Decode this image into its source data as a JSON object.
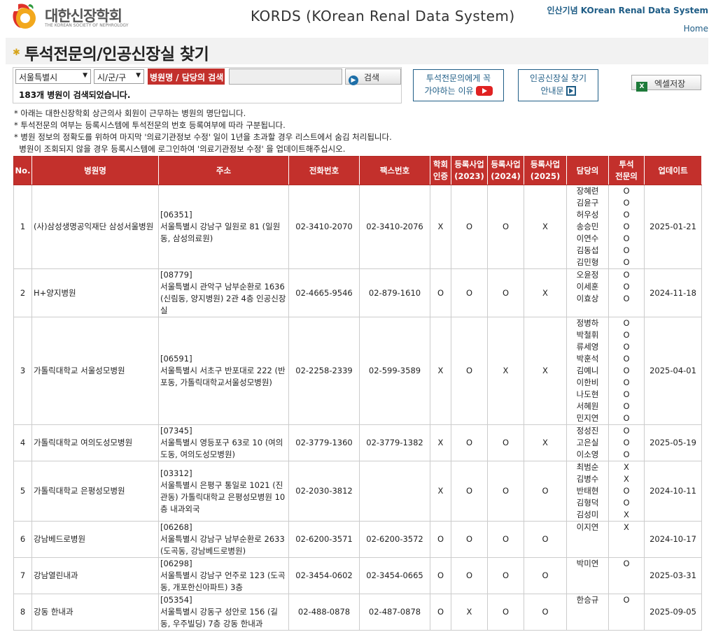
{
  "header": {
    "logo_text": "대한신장학회",
    "logo_sub": "THE KOREAN SOCIETY OF NEPHROLOGY",
    "app_title": "KORDS (KOrean Renal Data System)",
    "top_right": "인산기념 KOrean Renal Data System",
    "home_link": "Home"
  },
  "page": {
    "title": "투석전문의/인공신장실 찾기"
  },
  "search": {
    "region_value": "서울특별시",
    "district_value": "시/군/구",
    "label": "병원명 / 담당의 검색",
    "input_value": "",
    "button_label": "검색",
    "result_text": "183개 병원이 검색되었습니다."
  },
  "buttons": {
    "why_line1": "투석전문의에게 꼭",
    "why_line2": "가야하는 이유",
    "guide_line1": "인공신장실 찾기",
    "guide_line2": "안내문",
    "excel": "엑셀저장"
  },
  "notes": [
    "* 아래는 대한신장학회 상근의사 회원이 근무하는 병원의 명단입니다.",
    "* 투석전문의 여부는 등록시스템에 투석전문의 번호 등록여부에 따라 구분됩니다.",
    "* 병원 정보의 정확도를 위하여 마지막 '의료기관정보 수정' 일이 1년을 초과할 경우 리스트에서 숨김 처리됩니다.",
    "  병원이 조회되지 않을 경우 등록시스템에 로그인하여 '의료기관정보 수정' 을 업데이트해주십시오."
  ],
  "table": {
    "headers": [
      "No.",
      "병원명",
      "주소",
      "전화번호",
      "팩스번호",
      "학회\n인증",
      "등록사업\n(2023)",
      "등록사업\n(2024)",
      "등록사업\n(2025)",
      "담당의",
      "투석\n전문의",
      "업데이트"
    ],
    "rows": [
      {
        "no": "1",
        "name": "(사)삼성생명공익재단 삼성서울병원",
        "address": "[06351]\n서울특별시 강남구 일원로 81 (일원동, 삼성의료원)",
        "phone": "02-3410-2070",
        "fax": "02-3410-2076",
        "cert": "X",
        "r2023": "O",
        "r2024": "O",
        "r2025": "X",
        "doctors": [
          "장혜련",
          "김윤구",
          "허우성",
          "송승민",
          "이연수",
          "김동섭",
          "김민형"
        ],
        "specialist": [
          "O",
          "O",
          "O",
          "O",
          "O",
          "O",
          "O"
        ],
        "updated": "2025-01-21"
      },
      {
        "no": "2",
        "name": "H+양지병원",
        "address": "[08779]\n서울특별시 관악구 남부순환로 1636 (신림동, 양지병원) 2관 4층 인공신장실",
        "phone": "02-4665-9546",
        "fax": "02-879-1610",
        "cert": "O",
        "r2023": "O",
        "r2024": "O",
        "r2025": "X",
        "doctors": [
          "오윤정",
          "이세훈",
          "이효상"
        ],
        "specialist": [
          "O",
          "O",
          "O"
        ],
        "updated": "2024-11-18"
      },
      {
        "no": "3",
        "name": "가톨릭대학교 서울성모병원",
        "address": "[06591]\n서울특별시 서초구 반포대로 222 (반포동, 가톨릭대학교서울성모병원)",
        "phone": "02-2258-2339",
        "fax": "02-599-3589",
        "cert": "X",
        "r2023": "O",
        "r2024": "X",
        "r2025": "X",
        "doctors": [
          "정병하",
          "박철휘",
          "류세영",
          "박훈석",
          "김예니",
          "이한비",
          "나도현",
          "서혜원",
          "민지연"
        ],
        "specialist": [
          "O",
          "O",
          "O",
          "O",
          "O",
          "O",
          "O",
          "O",
          "O"
        ],
        "updated": "2025-04-01"
      },
      {
        "no": "4",
        "name": "가톨릭대학교 여의도성모병원",
        "address": "[07345]\n서울특별시 영등포구 63로 10 (여의도동, 여의도성모병원)",
        "phone": "02-3779-1360",
        "fax": "02-3779-1382",
        "cert": "X",
        "r2023": "O",
        "r2024": "O",
        "r2025": "X",
        "doctors": [
          "정성진",
          "고은실",
          "이소영"
        ],
        "specialist": [
          "O",
          "O",
          "O"
        ],
        "updated": "2025-05-19"
      },
      {
        "no": "5",
        "name": "가톨릭대학교 은평성모병원",
        "address": "[03312]\n서울특별시 은평구 통일로 1021 (진관동) 가톨릭대학교 은평성모병원 10층 내과외국",
        "phone": "02-2030-3812",
        "fax": "",
        "cert": "X",
        "r2023": "O",
        "r2024": "O",
        "r2025": "O",
        "doctors": [
          "최범순",
          "김병수",
          "반태현",
          "김형덕",
          "김성미"
        ],
        "specialist": [
          "X",
          "X",
          "O",
          "O",
          "X"
        ],
        "updated": "2024-10-11"
      },
      {
        "no": "6",
        "name": "강남베드로병원",
        "address": "[06268]\n서울특별시 강남구 남부순환로 2633 (도곡동, 강남베드로병원)",
        "phone": "02-6200-3571",
        "fax": "02-6200-3572",
        "cert": "O",
        "r2023": "O",
        "r2024": "O",
        "r2025": "O",
        "doctors": [
          "이지연"
        ],
        "specialist": [
          "X"
        ],
        "updated": "2024-10-17"
      },
      {
        "no": "7",
        "name": "강남열린내과",
        "address": "[06298]\n서울특별시 강남구 언주로 123 (도곡동, 개포한신아파트) 3층",
        "phone": "02-3454-0602",
        "fax": "02-3454-0665",
        "cert": "O",
        "r2023": "O",
        "r2024": "O",
        "r2025": "O",
        "doctors": [
          "박미연"
        ],
        "specialist": [
          "O"
        ],
        "updated": "2025-03-31"
      },
      {
        "no": "8",
        "name": "강동 한내과",
        "address": "[05354]\n서울특별시 강동구 성안로 156 (길동, 우주빌딩) 7층 강동 한내과",
        "phone": "02-488-0878",
        "fax": "02-487-0878",
        "cert": "O",
        "r2023": "X",
        "r2024": "O",
        "r2025": "O",
        "doctors": [
          "한승규"
        ],
        "specialist": [
          "O"
        ],
        "updated": "2025-09-05"
      }
    ]
  }
}
